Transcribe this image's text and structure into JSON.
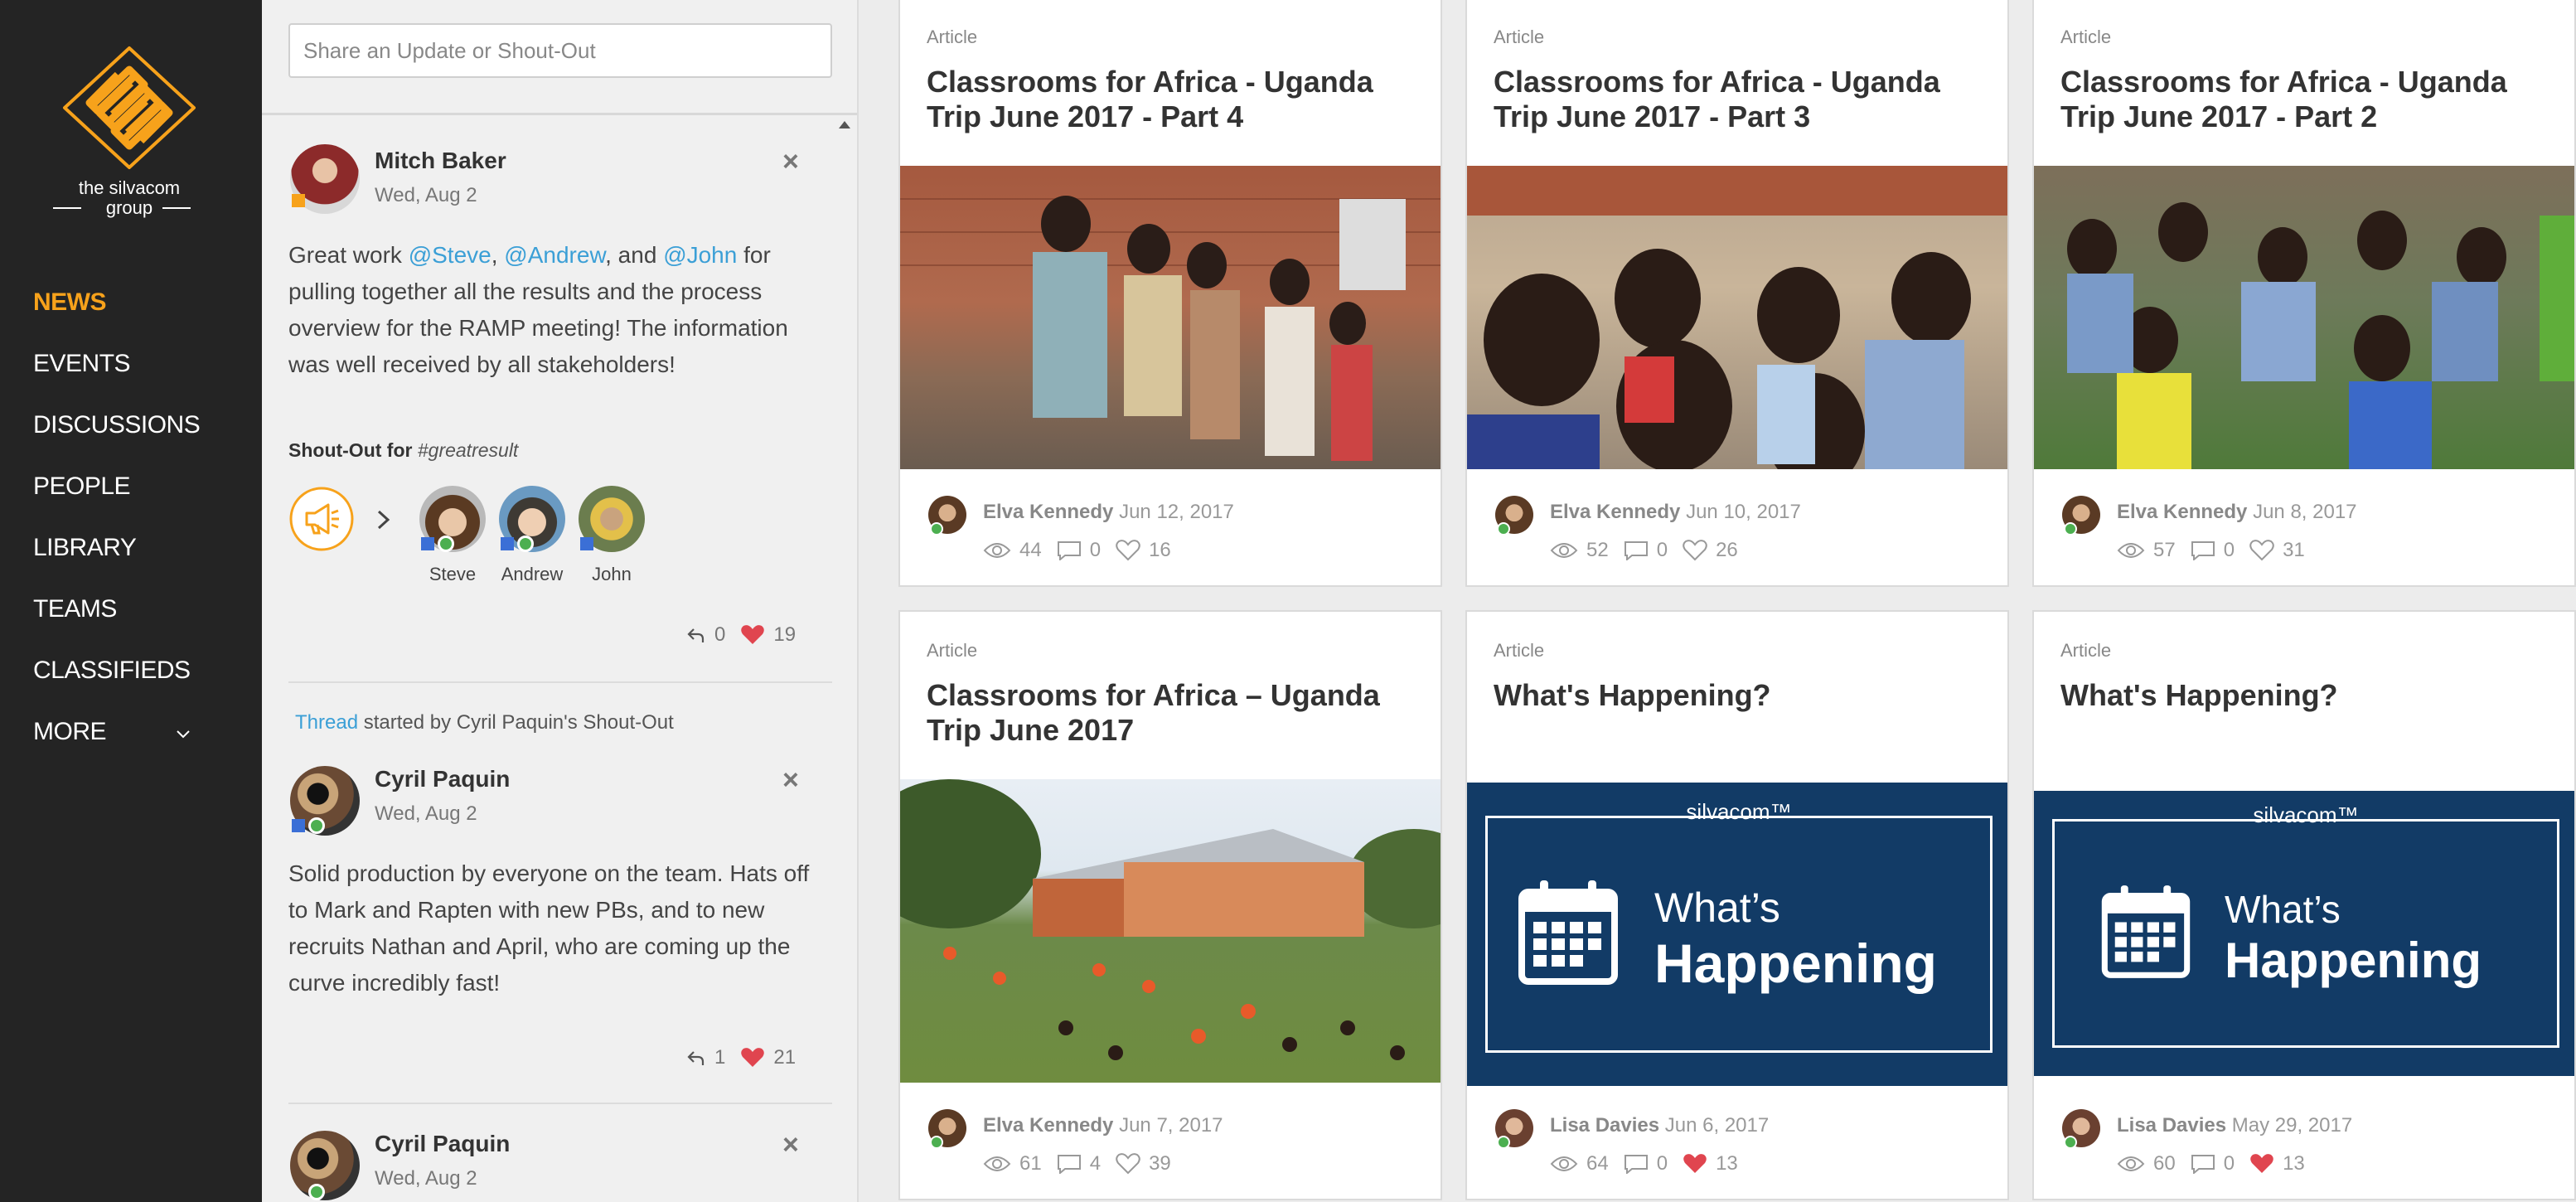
{
  "brand": {
    "line1": "the silvacom",
    "line2": "group"
  },
  "nav": {
    "items": [
      {
        "label": "NEWS",
        "active": true
      },
      {
        "label": "EVENTS"
      },
      {
        "label": "DISCUSSIONS"
      },
      {
        "label": "PEOPLE"
      },
      {
        "label": "LIBRARY"
      },
      {
        "label": "TEAMS"
      },
      {
        "label": "CLASSIFIEDS"
      },
      {
        "label": "MORE"
      }
    ]
  },
  "feed": {
    "share_placeholder": "Share an Update or Shout-Out",
    "posts": [
      {
        "name": "Mitch Baker",
        "date": "Wed, Aug 2",
        "body_a": "Great work ",
        "m1": "@Steve",
        "comma1": ", ",
        "m2": "@Andrew",
        "and": ", and ",
        "m3": "@John",
        "body_b": " for pulling together all the results and the process overview for the RAMP meeting! The information was well received by all stakeholders!",
        "shout_prefix": "Shout-Out",
        "shout_for": " for ",
        "shout_tag": "#greatresult",
        "recipients": [
          "Steve",
          "Andrew",
          "John"
        ],
        "replies": "0",
        "likes": "19"
      },
      {
        "thread_link": "Thread",
        "thread_rest": " started by Cyril Paquin's Shout-Out",
        "name": "Cyril Paquin",
        "date": "Wed, Aug 2",
        "body": "Solid production by everyone on the team. Hats off to Mark and Rapten with new PBs, and to new recruits Nathan and April, who are coming up the curve incredibly fast!",
        "replies": "1",
        "likes": "21"
      },
      {
        "name": "Cyril Paquin",
        "date": "Wed, Aug 2"
      }
    ]
  },
  "cards": [
    {
      "kind": "Article",
      "title": "Classrooms for Africa - Uganda Trip June 2017 - Part 4",
      "author": "Elva Kennedy",
      "date": "Jun 12, 2017",
      "views": "44",
      "comments": "0",
      "likes": "16",
      "liked": false
    },
    {
      "kind": "Article",
      "title": "Classrooms for Africa - Uganda Trip June 2017 - Part 3",
      "author": "Elva Kennedy",
      "date": "Jun 10, 2017",
      "views": "52",
      "comments": "0",
      "likes": "26",
      "liked": false
    },
    {
      "kind": "Article",
      "title": "Classrooms for Africa - Uganda Trip June 2017 - Part 2",
      "author": "Elva Kennedy",
      "date": "Jun 8, 2017",
      "views": "57",
      "comments": "0",
      "likes": "31",
      "liked": false
    },
    {
      "kind": "Article",
      "title": "Classrooms for Africa – Uganda Trip June 2017",
      "author": "Elva Kennedy",
      "date": "Jun 7, 2017",
      "views": "61",
      "comments": "4",
      "likes": "39",
      "liked": false
    },
    {
      "kind": "Article",
      "title": "What's Happening?",
      "author": "Lisa Davies",
      "date": "Jun 6, 2017",
      "views": "64",
      "comments": "0",
      "likes": "13",
      "liked": true,
      "banner": {
        "brand": "silvacom™",
        "line1": "What’s",
        "line2": "Happening"
      }
    },
    {
      "kind": "Article",
      "title": "What's Happening?",
      "author": "Lisa Davies",
      "date": "May 29, 2017",
      "views": "60",
      "comments": "0",
      "likes": "13",
      "liked": true,
      "banner": {
        "brand": "silvacom™",
        "line1": "What’s",
        "line2": "Happening"
      }
    }
  ],
  "colors": {
    "nav_bg": "#242424",
    "accent": "#f7a21b",
    "link": "#3b9fd6",
    "heart": "#e0454f",
    "banner": "#123b66"
  }
}
